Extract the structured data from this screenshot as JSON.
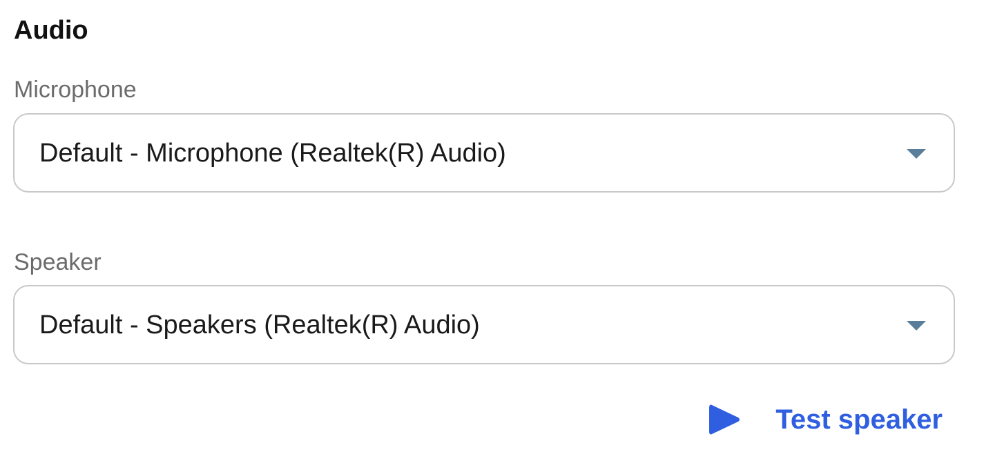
{
  "audio": {
    "title": "Audio",
    "microphone": {
      "label": "Microphone",
      "selected": "Default - Microphone (Realtek(R) Audio)"
    },
    "speaker": {
      "label": "Speaker",
      "selected": "Default - Speakers (Realtek(R) Audio)"
    },
    "test_speaker": {
      "label": "Test speaker",
      "icon": "play-icon"
    }
  },
  "colors": {
    "accent": "#2f5fe0",
    "chevron": "#5a7d9a",
    "label": "#6b6b6b",
    "border": "#c8c8c8"
  }
}
